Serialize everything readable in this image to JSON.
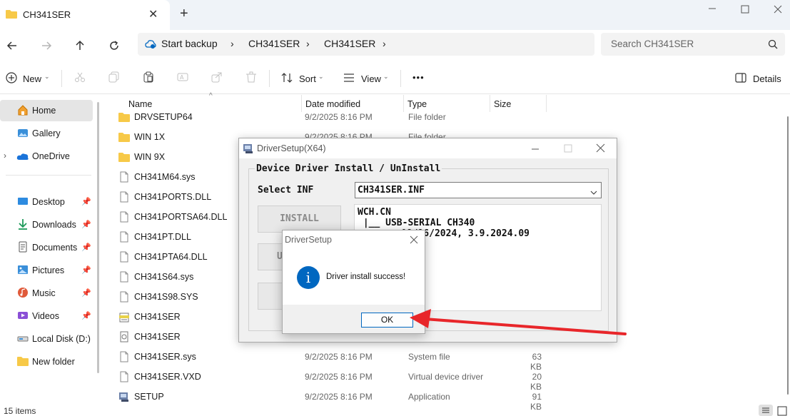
{
  "window": {
    "tab_title": "CH341SER",
    "tab_close": "✕",
    "new_tab": "+"
  },
  "address": {
    "backup_label": "Start backup",
    "crumbs": [
      "CH341SER",
      "CH341SER"
    ],
    "search_placeholder": "Search CH341SER"
  },
  "toolbar": {
    "new_label": "New",
    "sort_label": "Sort",
    "view_label": "View",
    "more_label": "•••",
    "details_label": "Details"
  },
  "sidebar": {
    "items": [
      {
        "label": "Home",
        "icon": "home-icon"
      },
      {
        "label": "Gallery",
        "icon": "gallery-icon"
      },
      {
        "label": "OneDrive",
        "icon": "cloud-icon"
      },
      {
        "label": "Desktop",
        "icon": "desktop-icon"
      },
      {
        "label": "Downloads",
        "icon": "download-icon"
      },
      {
        "label": "Documents",
        "icon": "document-icon"
      },
      {
        "label": "Pictures",
        "icon": "picture-icon"
      },
      {
        "label": "Music",
        "icon": "music-icon"
      },
      {
        "label": "Videos",
        "icon": "video-icon"
      },
      {
        "label": "Local Disk (D:)",
        "icon": "disk-icon"
      },
      {
        "label": "New folder",
        "icon": "folder-icon"
      }
    ]
  },
  "columns": {
    "name": "Name",
    "date": "Date modified",
    "type": "Type",
    "size": "Size"
  },
  "files": [
    {
      "name": "DRVSETUP64",
      "date": "9/2/2025 8:16 PM",
      "type": "File folder",
      "size": "",
      "kind": "folder"
    },
    {
      "name": "WIN 1X",
      "date": "9/2/2025 8:16 PM",
      "type": "File folder",
      "size": "",
      "kind": "folder"
    },
    {
      "name": "WIN 9X",
      "date": "",
      "type": "",
      "size": "",
      "kind": "folder"
    },
    {
      "name": "CH341M64.sys",
      "date": "",
      "type": "",
      "size": "",
      "kind": "file"
    },
    {
      "name": "CH341PORTS.DLL",
      "date": "",
      "type": "",
      "size": "",
      "kind": "file"
    },
    {
      "name": "CH341PORTSA64.DLL",
      "date": "",
      "type": "",
      "size": "",
      "kind": "file"
    },
    {
      "name": "CH341PT.DLL",
      "date": "",
      "type": "",
      "size": "",
      "kind": "file"
    },
    {
      "name": "CH341PTA64.DLL",
      "date": "",
      "type": "",
      "size": "",
      "kind": "file"
    },
    {
      "name": "CH341S64.sys",
      "date": "",
      "type": "",
      "size": "",
      "kind": "file"
    },
    {
      "name": "CH341S98.SYS",
      "date": "",
      "type": "",
      "size": "",
      "kind": "file"
    },
    {
      "name": "CH341SER",
      "date": "",
      "type": "",
      "size": "",
      "kind": "inf"
    },
    {
      "name": "CH341SER",
      "date": "",
      "type": "",
      "size": "",
      "kind": "cat"
    },
    {
      "name": "CH341SER.sys",
      "date": "9/2/2025 8:16 PM",
      "type": "System file",
      "size": "63 KB",
      "kind": "file"
    },
    {
      "name": "CH341SER.VXD",
      "date": "9/2/2025 8:16 PM",
      "type": "Virtual device driver",
      "size": "20 KB",
      "kind": "file"
    },
    {
      "name": "SETUP",
      "date": "9/2/2025 8:16 PM",
      "type": "Application",
      "size": "91 KB",
      "kind": "app"
    }
  ],
  "status": {
    "count": "15 items"
  },
  "driver_setup": {
    "title": "DriverSetup(X64)",
    "group_label": "Device Driver Install / UnInstall",
    "select_inf_label": "Select INF",
    "inf_value": "CH341SER.INF",
    "install_label": "INSTALL",
    "uninstall_partial": "U",
    "info_line1": "WCH.CN",
    "info_line2": " |__ USB-SERIAL CH340",
    "info_line3": "09/16/2024, 3.9.2024.09"
  },
  "message": {
    "title": "DriverSetup",
    "text": "Driver install success!",
    "ok_label": "OK",
    "info_glyph": "i"
  },
  "colors": {
    "arrow": "#e8262a",
    "info_blue": "#0067c0",
    "folder": "#f7c948"
  }
}
